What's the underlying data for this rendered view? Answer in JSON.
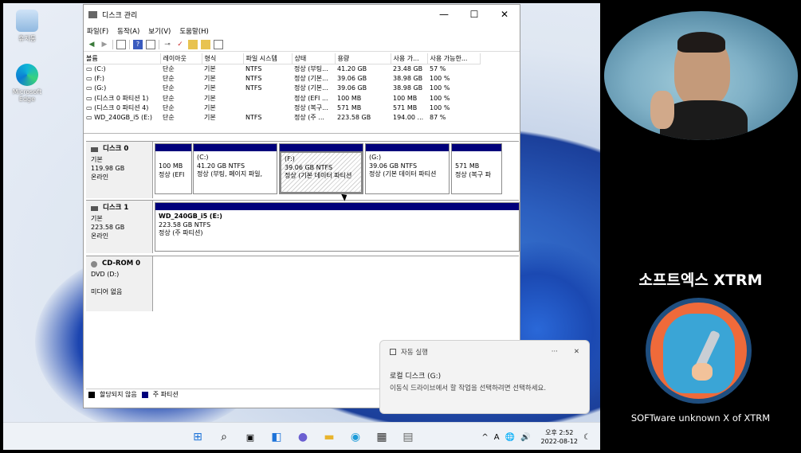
{
  "desktop": {
    "icons": [
      {
        "label": "휴지통",
        "icon": "recycle-bin-icon"
      },
      {
        "label": "Microsoft Edge",
        "icon": "edge-icon"
      }
    ]
  },
  "window": {
    "title": "디스크 관리",
    "controls": {
      "minimize": "—",
      "maximize": "☐",
      "close": "✕"
    },
    "menu": [
      "파일(F)",
      "동작(A)",
      "보기(V)",
      "도움말(H)"
    ],
    "toolbar": [
      "back-icon",
      "forward-icon",
      "console-icon",
      "help-icon",
      "properties-icon",
      "connect-icon",
      "check-icon",
      "folder-icon",
      "export-icon",
      "list-icon"
    ]
  },
  "volumes": {
    "columns": [
      "볼륨",
      "레이아웃",
      "형식",
      "파일 시스템",
      "상태",
      "용량",
      "사용 가...",
      "사용 가능한..."
    ],
    "rows": [
      [
        "(C:)",
        "단순",
        "기본",
        "NTFS",
        "정상 (부팅...",
        "41.20 GB",
        "23.48 GB",
        "57 %"
      ],
      [
        "(F:)",
        "단순",
        "기본",
        "NTFS",
        "정상 (기본...",
        "39.06 GB",
        "38.98 GB",
        "100 %"
      ],
      [
        "(G:)",
        "단순",
        "기본",
        "NTFS",
        "정상 (기본...",
        "39.06 GB",
        "38.98 GB",
        "100 %"
      ],
      [
        "(디스크 0 파티션 1)",
        "단순",
        "기본",
        "",
        "정상 (EFI ...",
        "100 MB",
        "100 MB",
        "100 %"
      ],
      [
        "(디스크 0 파티션 4)",
        "단순",
        "기본",
        "",
        "정상 (복구...",
        "571 MB",
        "571 MB",
        "100 %"
      ],
      [
        "WD_240GB_i5 (E:)",
        "단순",
        "기본",
        "NTFS",
        "정상 (주 ...",
        "223.58 GB",
        "194.00 ...",
        "87 %"
      ]
    ]
  },
  "disks": [
    {
      "name": "디스크 0",
      "type": "기본",
      "size": "119.98 GB",
      "state": "온라인",
      "partitions": [
        {
          "title": "",
          "line1": "100 MB",
          "line2": "정상 (EFI"
        },
        {
          "title": "(C:)",
          "line1": "41.20 GB NTFS",
          "line2": "정상 (부팅, 페이지 파일,"
        },
        {
          "title": "(F:)",
          "line1": "39.06 GB NTFS",
          "line2": "정상 (기본 데이터 파티션"
        },
        {
          "title": "(G:)",
          "line1": "39.06 GB NTFS",
          "line2": "정상 (기본 데이터 파티션"
        },
        {
          "title": "",
          "line1": "571 MB",
          "line2": "정상 (복구 파"
        }
      ]
    },
    {
      "name": "디스크 1",
      "type": "기본",
      "size": "223.58 GB",
      "state": "온라인",
      "partitions": [
        {
          "title": "WD_240GB_i5  (E:)",
          "line1": "223.58 GB NTFS",
          "line2": "정상 (주 파티션)"
        }
      ]
    },
    {
      "name": "CD-ROM 0",
      "type": "DVD (D:)",
      "size": "",
      "state": "미디어 없음",
      "partitions": []
    }
  ],
  "legend": [
    {
      "label": "할당되지 않음",
      "color": "#000000"
    },
    {
      "label": "주 파티션",
      "color": "#00007b"
    }
  ],
  "notification": {
    "app": "자동 실행",
    "more": "···",
    "close": "✕",
    "title": "로컬 디스크 (G:)",
    "body": "이동식 드라이브에서 할 작업을 선택하려면 선택하세요."
  },
  "taskbar": {
    "apps": [
      "windows-start-icon",
      "search-icon",
      "task-view-icon",
      "widgets-icon",
      "teams-chat-icon",
      "file-explorer-icon",
      "edge-icon",
      "store-icon",
      "disk-management-icon"
    ],
    "tray": {
      "chevron": "^",
      "ime": "A",
      "network": "🌐",
      "volume": "🔊"
    },
    "clock_time": "오후 2:52",
    "clock_date": "2022-08-12"
  },
  "right_panel": {
    "brand": "소프트엑스 XTRM",
    "tagline": "SOFTware unknown X of XTRM"
  }
}
